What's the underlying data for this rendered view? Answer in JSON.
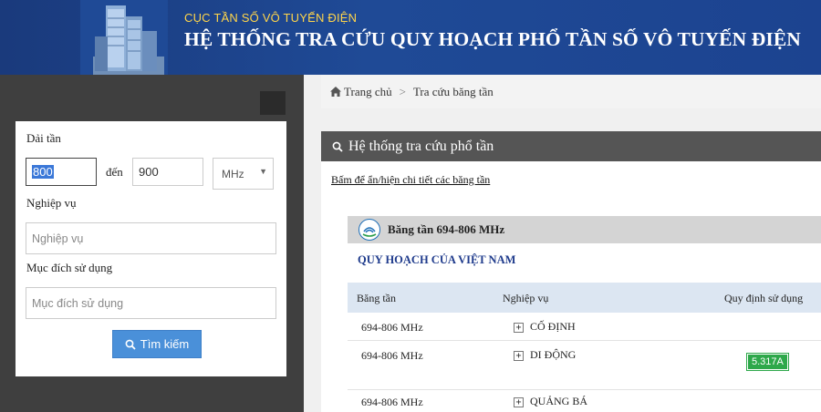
{
  "header": {
    "org_name": "CỤC TẦN SỐ VÔ TUYẾN ĐIỆN",
    "system_title": "HỆ THỐNG TRA CỨU QUY HOẠCH PHỔ TẦN SỐ VÔ TUYẾN ĐIỆN"
  },
  "search_form": {
    "range_label": "Dải tần",
    "from_value": "800",
    "to_label": "đến",
    "to_value": "900",
    "unit_value": "MHz",
    "service_label": "Nghiệp vụ",
    "service_placeholder": "Nghiệp vụ",
    "purpose_label": "Mục đích sử dụng",
    "purpose_placeholder": "Mục đích sử dụng",
    "search_button": "Tìm kiếm"
  },
  "breadcrumb": {
    "home": "Trang chủ",
    "separator": ">",
    "current": "Tra cứu băng tần"
  },
  "panel": {
    "title": "Hệ thống tra cứu phổ tần",
    "toggle_link": "Bấm để ẩn/hiện chi tiết các băng tần"
  },
  "band": {
    "title": "Băng tần 694-806 MHz",
    "plan_title": "QUY HOẠCH CỦA VIỆT NAM",
    "columns": [
      "Băng tần",
      "Nghiệp vụ",
      "Quy định sử dụng"
    ],
    "rows": [
      {
        "band": "694-806 MHz",
        "service": "CỐ ĐỊNH",
        "rule": ""
      },
      {
        "band": "694-806 MHz",
        "service": "DI ĐỘNG",
        "rule": "5.317A"
      },
      {
        "band": "694-806 MHz",
        "service": "QUẢNG BÁ",
        "rule": ""
      }
    ]
  },
  "colors": {
    "header_blue": "#1f4a96",
    "accent_yellow": "#ffd54a",
    "button_blue": "#4a90d9",
    "badge_green": "#2ea84a",
    "plan_title_blue": "#1f3b8c"
  }
}
